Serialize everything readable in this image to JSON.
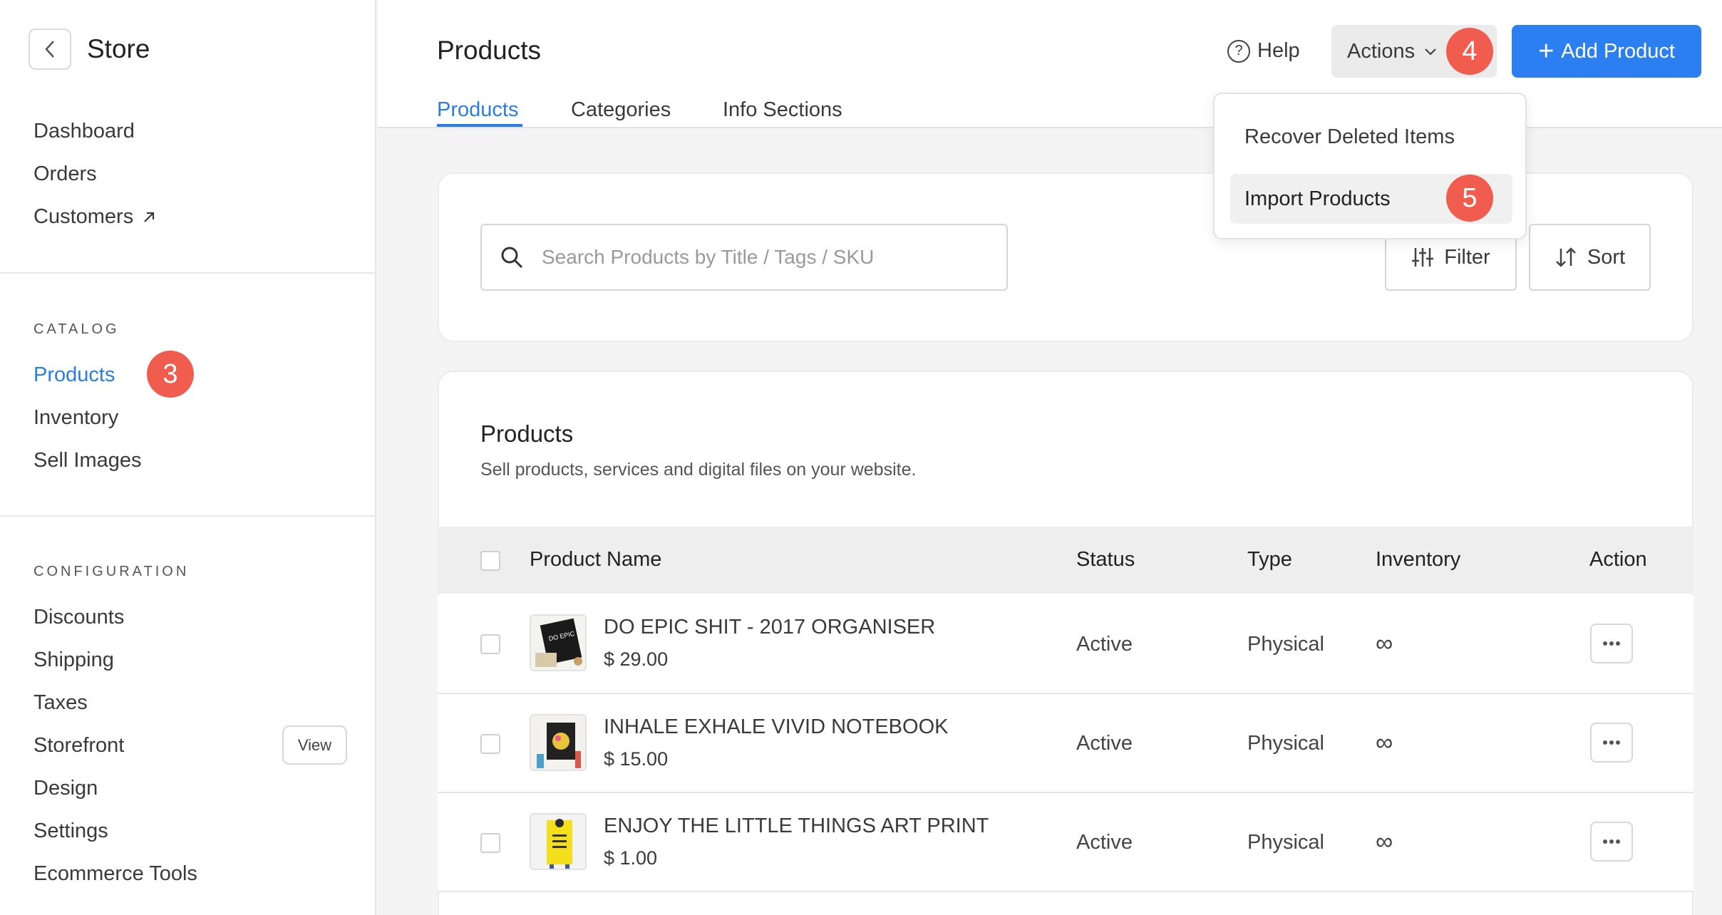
{
  "sidebar": {
    "title": "Store",
    "main_items": [
      "Dashboard",
      "Orders",
      "Customers"
    ],
    "catalog_heading": "CATALOG",
    "catalog_items": [
      "Products",
      "Inventory",
      "Sell Images"
    ],
    "config_heading": "CONFIGURATION",
    "config_items": [
      "Discounts",
      "Shipping",
      "Taxes",
      "Storefront",
      "Design",
      "Settings",
      "Ecommerce Tools"
    ],
    "view_label": "View"
  },
  "badges": {
    "b3": "3",
    "b4": "4",
    "b5": "5"
  },
  "header": {
    "title": "Products",
    "tabs": [
      "Products",
      "Categories",
      "Info Sections"
    ],
    "help_label": "Help",
    "actions_label": "Actions",
    "add_label": "Add Product"
  },
  "dropdown": {
    "items": [
      "Recover Deleted Items",
      "Import Products"
    ]
  },
  "filters": {
    "search_placeholder": "Search Products by Title / Tags / SKU",
    "filter_label": "Filter",
    "sort_label": "Sort"
  },
  "products": {
    "title": "Products",
    "subtitle": "Sell products, services and digital files on your website.",
    "columns": [
      "Product Name",
      "Status",
      "Type",
      "Inventory",
      "Action"
    ],
    "rows": [
      {
        "name": "DO EPIC SHIT - 2017 ORGANISER",
        "price": "$ 29.00",
        "status": "Active",
        "type": "Physical",
        "inventory": "∞"
      },
      {
        "name": "INHALE EXHALE VIVID NOTEBOOK",
        "price": "$ 15.00",
        "status": "Active",
        "type": "Physical",
        "inventory": "∞"
      },
      {
        "name": "ENJOY THE LITTLE THINGS ART PRINT",
        "price": "$ 1.00",
        "status": "Active",
        "type": "Physical",
        "inventory": "∞"
      }
    ]
  },
  "colors": {
    "accent": "#2a7de1",
    "primary_button": "#2b7ff0",
    "badge": "#f05d4e"
  }
}
